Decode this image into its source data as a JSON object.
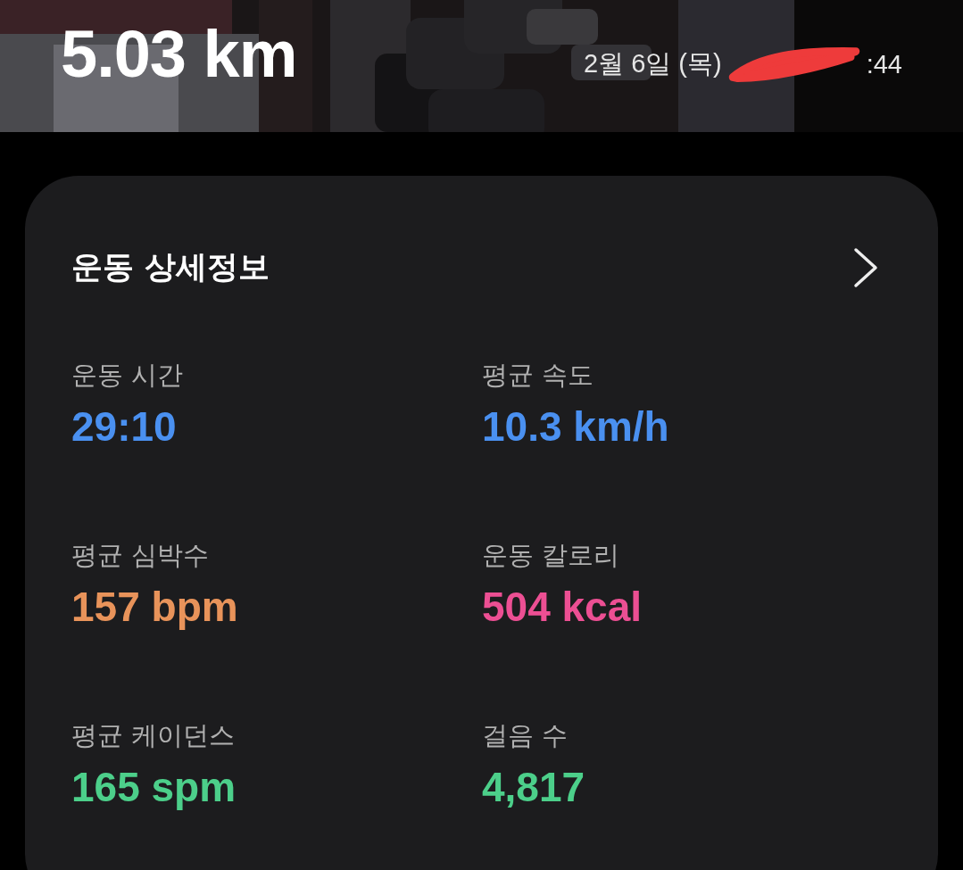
{
  "header": {
    "kind": "picture",
    "distance": "5.03 km",
    "date": "2월 6일 (목)",
    "time_tail": ":44",
    "redacted": true
  },
  "card": {
    "title": "운동 상세정보",
    "metrics": [
      {
        "label": "운동 시간",
        "value": "29:10",
        "color": "#4a90f0"
      },
      {
        "label": "평균 속도",
        "value": "10.3 km/h",
        "color": "#4a90f0"
      },
      {
        "label": "평균 심박수",
        "value": "157 bpm",
        "color": "#e8935a"
      },
      {
        "label": "운동 칼로리",
        "value": "504 kcal",
        "color": "#ec4f93"
      },
      {
        "label": "평균 케이던스",
        "value": "165 spm",
        "color": "#4ccf8a"
      },
      {
        "label": "걸음 수",
        "value": "4,817",
        "color": "#4ccf8a"
      }
    ]
  }
}
